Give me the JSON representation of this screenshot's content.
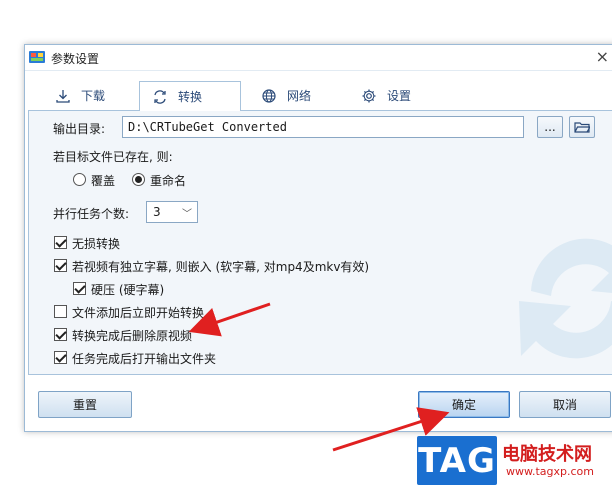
{
  "window": {
    "title": "参数设置",
    "close": "×"
  },
  "tabs": [
    {
      "label": "下载",
      "icon": "download-icon"
    },
    {
      "label": "转换",
      "icon": "convert-icon",
      "active": true
    },
    {
      "label": "网络",
      "icon": "globe-icon"
    },
    {
      "label": "设置",
      "icon": "gear-icon"
    }
  ],
  "output": {
    "label": "输出目录:",
    "value": "D:\\CRTubeGet Converted",
    "browse": "..."
  },
  "exists": {
    "label": "若目标文件已存在, 则:",
    "options": [
      {
        "label": "覆盖",
        "selected": false
      },
      {
        "label": "重命名",
        "selected": true
      }
    ]
  },
  "parallel": {
    "label": "并行任务个数:",
    "value": "3"
  },
  "checkboxes": [
    {
      "label": "无损转换",
      "checked": true
    },
    {
      "label": "若视频有独立字幕, 则嵌入 (软字幕, 对mp4及mkv有效)",
      "checked": true
    },
    {
      "label": "硬压 (硬字幕)",
      "checked": true
    },
    {
      "label": "文件添加后立即开始转换",
      "checked": false
    },
    {
      "label": "转换完成后删除原视频",
      "checked": true
    },
    {
      "label": "任务完成后打开输出文件夹",
      "checked": true
    }
  ],
  "footer": {
    "reset": "重置",
    "ok": "确定",
    "cancel": "取消"
  },
  "watermark": {
    "logo": "TAG",
    "site_name": "电脑技术网",
    "url": "www.tagxp.com"
  },
  "colors": {
    "accent": "#3a78c2",
    "annotation_arrow": "#e02020",
    "logo_bg": "#1a6fd0"
  }
}
